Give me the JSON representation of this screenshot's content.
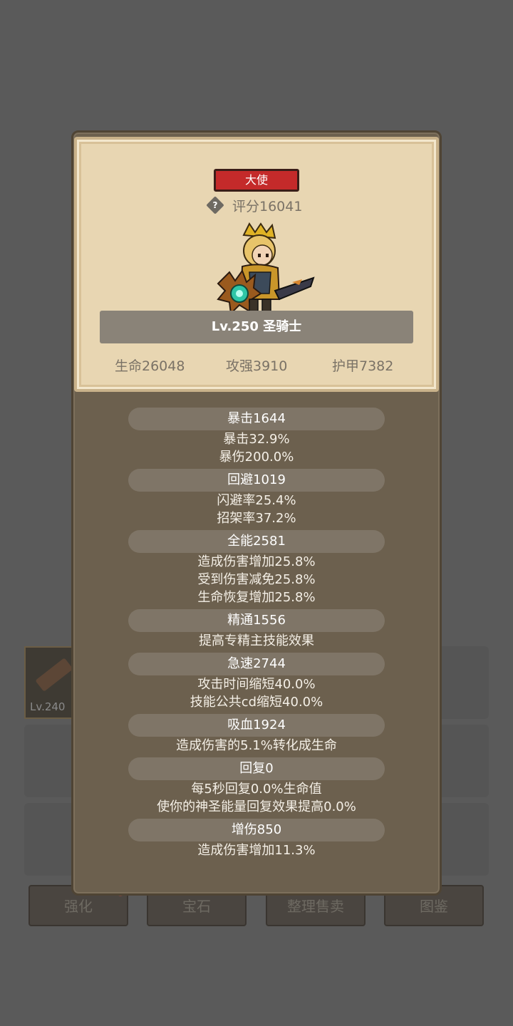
{
  "background": {
    "item": {
      "level": "Lv.240"
    },
    "buttons": [
      {
        "label": "强化"
      },
      {
        "label": "宝石"
      },
      {
        "label": "整理售卖"
      },
      {
        "label": "图鉴"
      }
    ]
  },
  "panel": {
    "title_badge": "大使",
    "score": "评分16041",
    "help_icon_glyph": "?",
    "class_label": "Lv.250 圣骑士",
    "stats": [
      {
        "label": "生命26048"
      },
      {
        "label": "攻强3910"
      },
      {
        "label": "护甲7382"
      }
    ]
  },
  "attributes": [
    {
      "header": "暴击1644",
      "lines": [
        "暴击32.9%",
        "暴伤200.0%"
      ]
    },
    {
      "header": "回避1019",
      "lines": [
        "闪避率25.4%",
        "招架率37.2%"
      ]
    },
    {
      "header": "全能2581",
      "lines": [
        "造成伤害增加25.8%",
        "受到伤害减免25.8%",
        "生命恢复增加25.8%"
      ]
    },
    {
      "header": "精通1556",
      "lines": [
        "提高专精主技能效果"
      ]
    },
    {
      "header": "急速2744",
      "lines": [
        "攻击时间缩短40.0%",
        "技能公共cd缩短40.0%"
      ]
    },
    {
      "header": "吸血1924",
      "lines": [
        "造成伤害的5.1%转化成生命"
      ]
    },
    {
      "header": "回复0",
      "lines": [
        "每5秒回复0.0%生命值",
        "使你的神圣能量回复效果提高0.0%"
      ]
    },
    {
      "header": "增伤850",
      "lines": [
        "造成伤害增加11.3%"
      ]
    }
  ],
  "colors": {
    "badge_red": "#c42a2a",
    "parchment": "#e8d6b2",
    "panel_brown": "#6c604e"
  }
}
